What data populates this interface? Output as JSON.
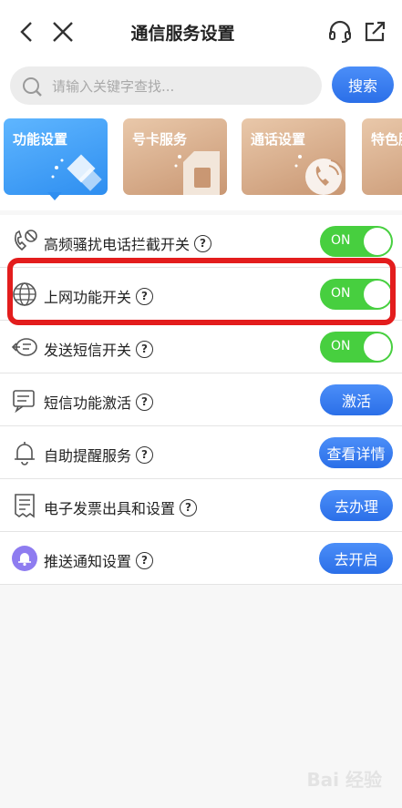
{
  "header": {
    "title": "通信服务设置",
    "back_icon": "chevron-left",
    "close_icon": "close-x",
    "support_icon": "headset",
    "share_icon": "share-out"
  },
  "search": {
    "placeholder": "请输入关键字查找...",
    "button": "搜索"
  },
  "categories": [
    {
      "label": "功能设置",
      "active": true
    },
    {
      "label": "号卡服务",
      "active": false
    },
    {
      "label": "通话设置",
      "active": false
    },
    {
      "label": "特色服",
      "active": false
    }
  ],
  "rows": [
    {
      "label": "高频骚扰电话拦截开关",
      "control": "toggle",
      "value": "ON"
    },
    {
      "label": "上网功能开关",
      "control": "toggle",
      "value": "ON"
    },
    {
      "label": "发送短信开关",
      "control": "toggle",
      "value": "ON"
    },
    {
      "label": "短信功能激活",
      "control": "button",
      "value": "激活"
    },
    {
      "label": "自助提醒服务",
      "control": "button",
      "value": "查看详情"
    },
    {
      "label": "电子发票出具和设置",
      "control": "button",
      "value": "去办理"
    },
    {
      "label": "推送通知设置",
      "control": "button",
      "value": "去开启"
    }
  ],
  "help_symbol": "?",
  "colors": {
    "accent_blue": "#2b6fe8",
    "toggle_green": "#47cf3f",
    "highlight_red": "#e31d1d"
  },
  "watermark": "Bai 经验"
}
